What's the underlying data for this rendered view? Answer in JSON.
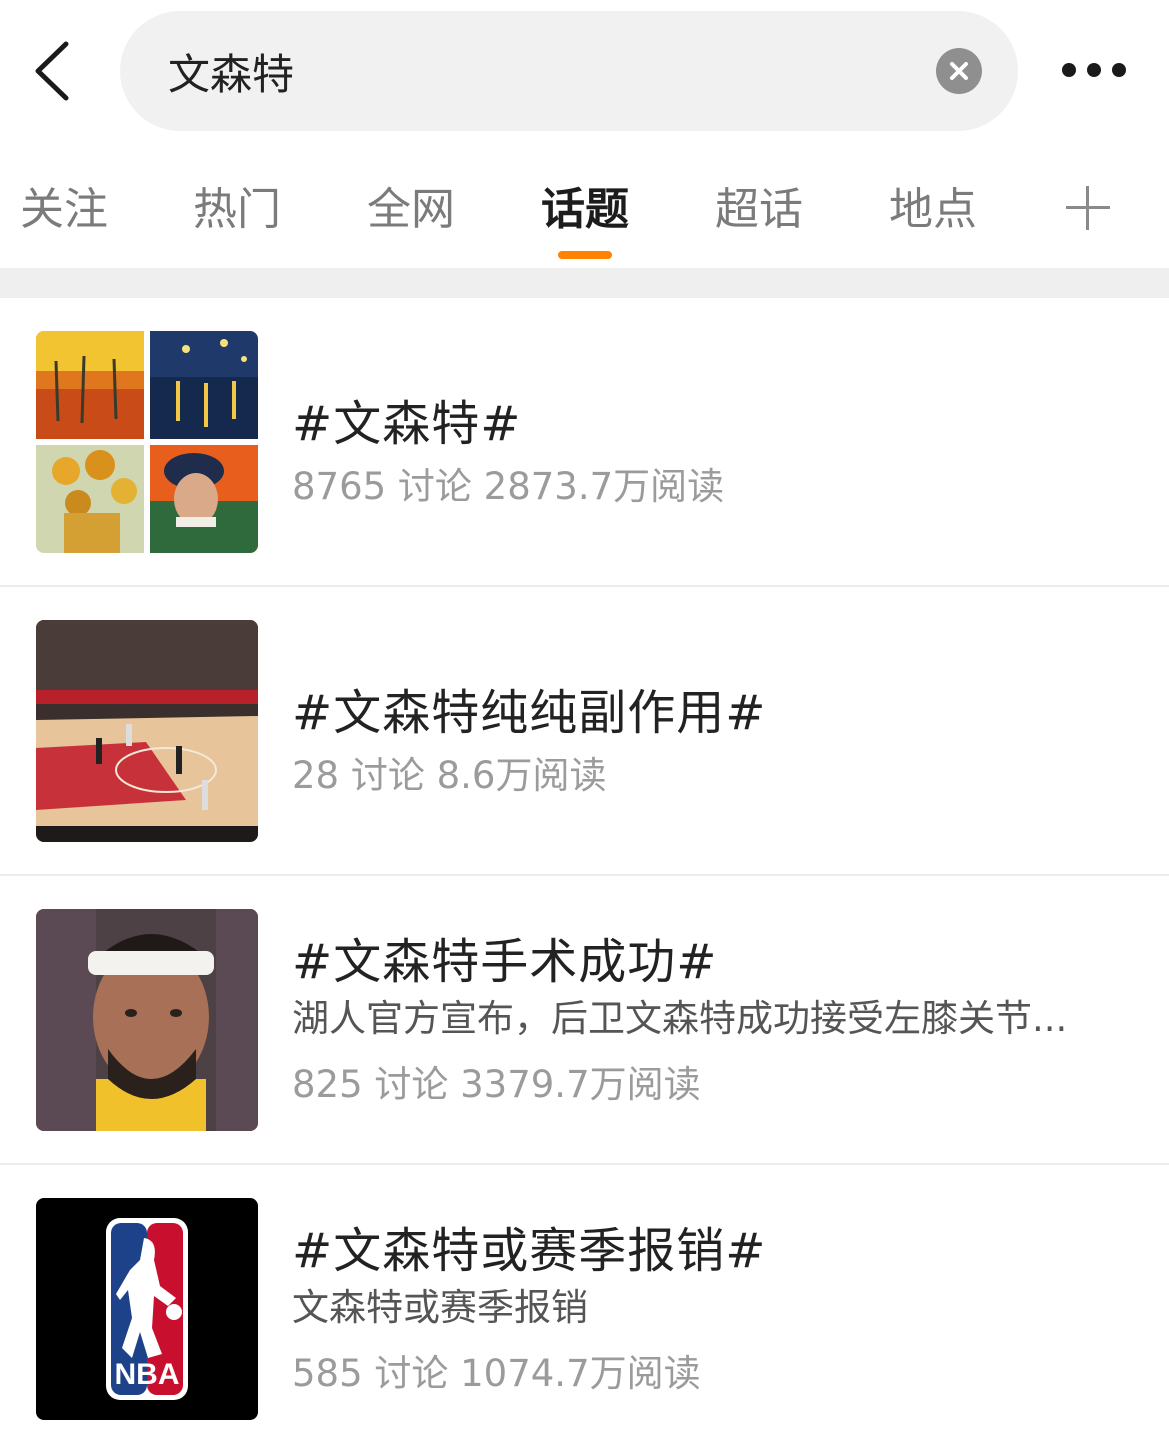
{
  "search": {
    "query": "文森特"
  },
  "tabs": [
    {
      "label": "关注"
    },
    {
      "label": "热门"
    },
    {
      "label": "全网"
    },
    {
      "label": "话题",
      "active": true
    },
    {
      "label": "超话"
    },
    {
      "label": "地点"
    }
  ],
  "colors": {
    "accent": "#ff8200",
    "tab_inactive": "#7b7b7b",
    "stats": "#9b9b9b"
  },
  "topics": [
    {
      "title": "#文森特#",
      "stats": "8765 讨论 2873.7万阅读",
      "thumb_icon": "vangogh-collage-thumbnail"
    },
    {
      "title": "#文森特纯纯副作用#",
      "stats": "28 讨论 8.6万阅读",
      "thumb_icon": "basketball-court-thumbnail"
    },
    {
      "title": "#文森特手术成功#",
      "subtitle": "湖人官方宣布，后卫文森特成功接受左膝关节...",
      "stats": "825 讨论 3379.7万阅读",
      "thumb_icon": "player-portrait-thumbnail"
    },
    {
      "title": "#文森特或赛季报销#",
      "subtitle": "文森特或赛季报销",
      "stats": "585 讨论 1074.7万阅读",
      "thumb_icon": "nba-logo-thumbnail",
      "logo_text": "NBA"
    }
  ]
}
